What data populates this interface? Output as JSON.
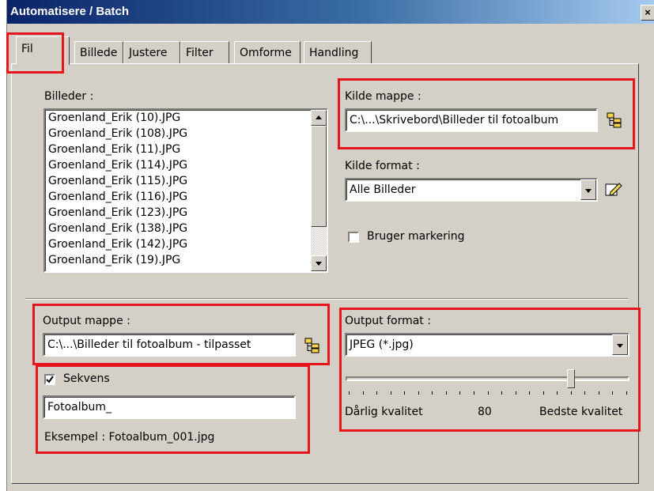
{
  "window": {
    "title": "Automatisere / Batch",
    "close_label": "×"
  },
  "tabs": [
    {
      "label": "Fil",
      "active": true
    },
    {
      "label": "Billede"
    },
    {
      "label": "Justere"
    },
    {
      "label": "Filter"
    },
    {
      "label": "Omforme"
    },
    {
      "label": "Handling"
    }
  ],
  "images": {
    "label": "Billeder :",
    "items": [
      "Groenland_Erik (10).JPG",
      "Groenland_Erik (108).JPG",
      "Groenland_Erik (11).JPG",
      "Groenland_Erik (114).JPG",
      "Groenland_Erik (115).JPG",
      "Groenland_Erik (116).JPG",
      "Groenland_Erik (123).JPG",
      "Groenland_Erik (138).JPG",
      "Groenland_Erik (142).JPG",
      "Groenland_Erik (19).JPG"
    ]
  },
  "source_folder": {
    "label": "Kilde mappe :",
    "value": "C:\\...\\Skrivebord\\Billeder til fotoalbum"
  },
  "source_format": {
    "label": "Kilde format :",
    "value": "Alle Billeder"
  },
  "use_selection": {
    "label": "Bruger markering",
    "checked": false
  },
  "output_folder": {
    "label": "Output mappe :",
    "value": "C:\\...\\Billeder til fotoalbum - tilpasset"
  },
  "sequence": {
    "label": "Sekvens",
    "checked": true,
    "value": "Fotoalbum_",
    "example": "Eksempel : Fotoalbum_001.jpg"
  },
  "output_format": {
    "label": "Output format :",
    "value": "JPEG (*.jpg)"
  },
  "quality": {
    "min_label": "Dårlig kvalitet",
    "value_label": "80",
    "max_label": "Bedste kvalitet",
    "value": 80,
    "min": 0,
    "max": 100
  },
  "icons": {
    "folder_browse": "folder-tree-icon",
    "edit_format": "edit-pencil-icon",
    "check": "check-icon",
    "arrow_up": "arrow-up-icon",
    "arrow_down": "arrow-down-icon"
  },
  "colors": {
    "title_start": "#0a246a",
    "title_end": "#a6caf0",
    "highlight": "#e6141b",
    "face": "#d4d0c8"
  }
}
